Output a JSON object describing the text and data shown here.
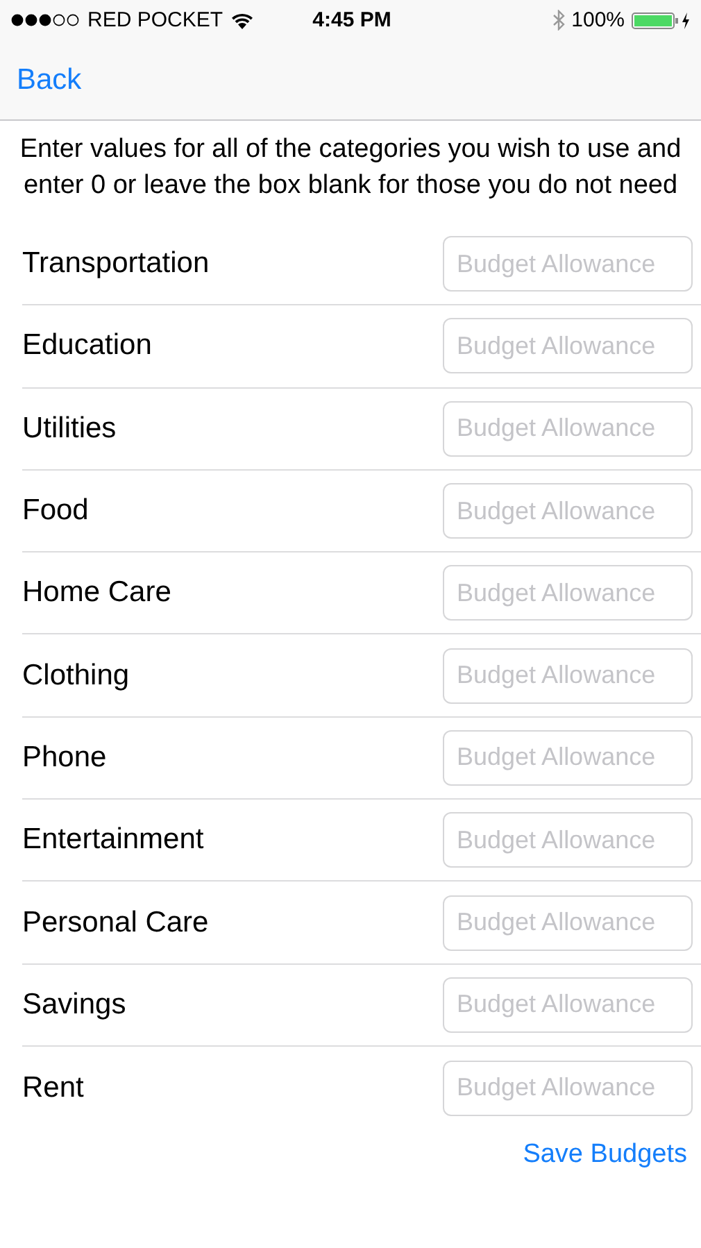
{
  "status_bar": {
    "carrier": "RED POCKET",
    "time": "4:45 PM",
    "battery": "100%"
  },
  "nav": {
    "back": "Back"
  },
  "instructions": "Enter values for all of the categories you wish to use and enter 0 or leave the box blank for those you do not need",
  "categories": [
    {
      "label": "Transportation",
      "placeholder": "Budget Allowance"
    },
    {
      "label": "Education",
      "placeholder": "Budget Allowance"
    },
    {
      "label": "Utilities",
      "placeholder": "Budget Allowance"
    },
    {
      "label": "Food",
      "placeholder": "Budget Allowance"
    },
    {
      "label": "Home Care",
      "placeholder": "Budget Allowance"
    },
    {
      "label": "Clothing",
      "placeholder": "Budget Allowance"
    },
    {
      "label": "Phone",
      "placeholder": "Budget Allowance"
    },
    {
      "label": "Entertainment",
      "placeholder": "Budget Allowance"
    },
    {
      "label": "Personal Care",
      "placeholder": "Budget Allowance"
    },
    {
      "label": "Savings",
      "placeholder": "Budget Allowance"
    },
    {
      "label": "Rent",
      "placeholder": "Budget Allowance"
    }
  ],
  "save_button": "Save Budgets"
}
